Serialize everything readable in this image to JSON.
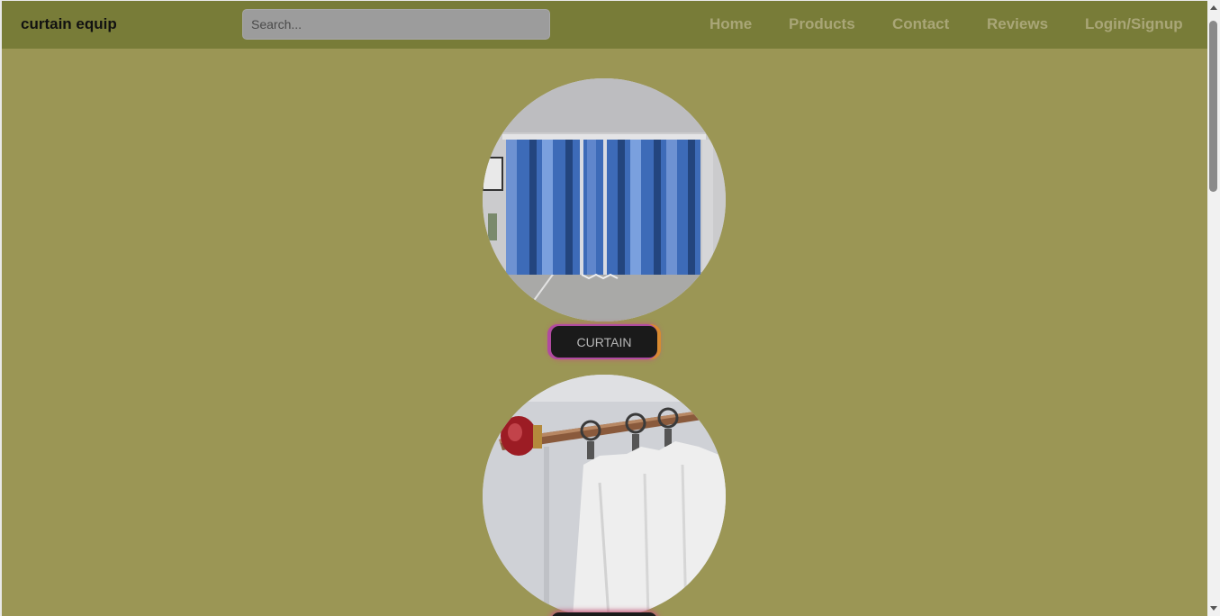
{
  "site": {
    "brand": "curtain equip"
  },
  "search": {
    "placeholder": "Search..."
  },
  "nav": {
    "home": "Home",
    "products": "Products",
    "contact": "Contact",
    "reviews": "Reviews",
    "login": "Login/Signup"
  },
  "categories": [
    {
      "label": "CURTAIN",
      "image": "blue-curtain-photo"
    },
    {
      "label": "",
      "image": "curtain-rod-photo"
    }
  ],
  "colors": {
    "navbar": "#787c38",
    "page_background": "#9b9655",
    "nav_link": "#a9a677",
    "button_background": "#1a1a1a"
  }
}
